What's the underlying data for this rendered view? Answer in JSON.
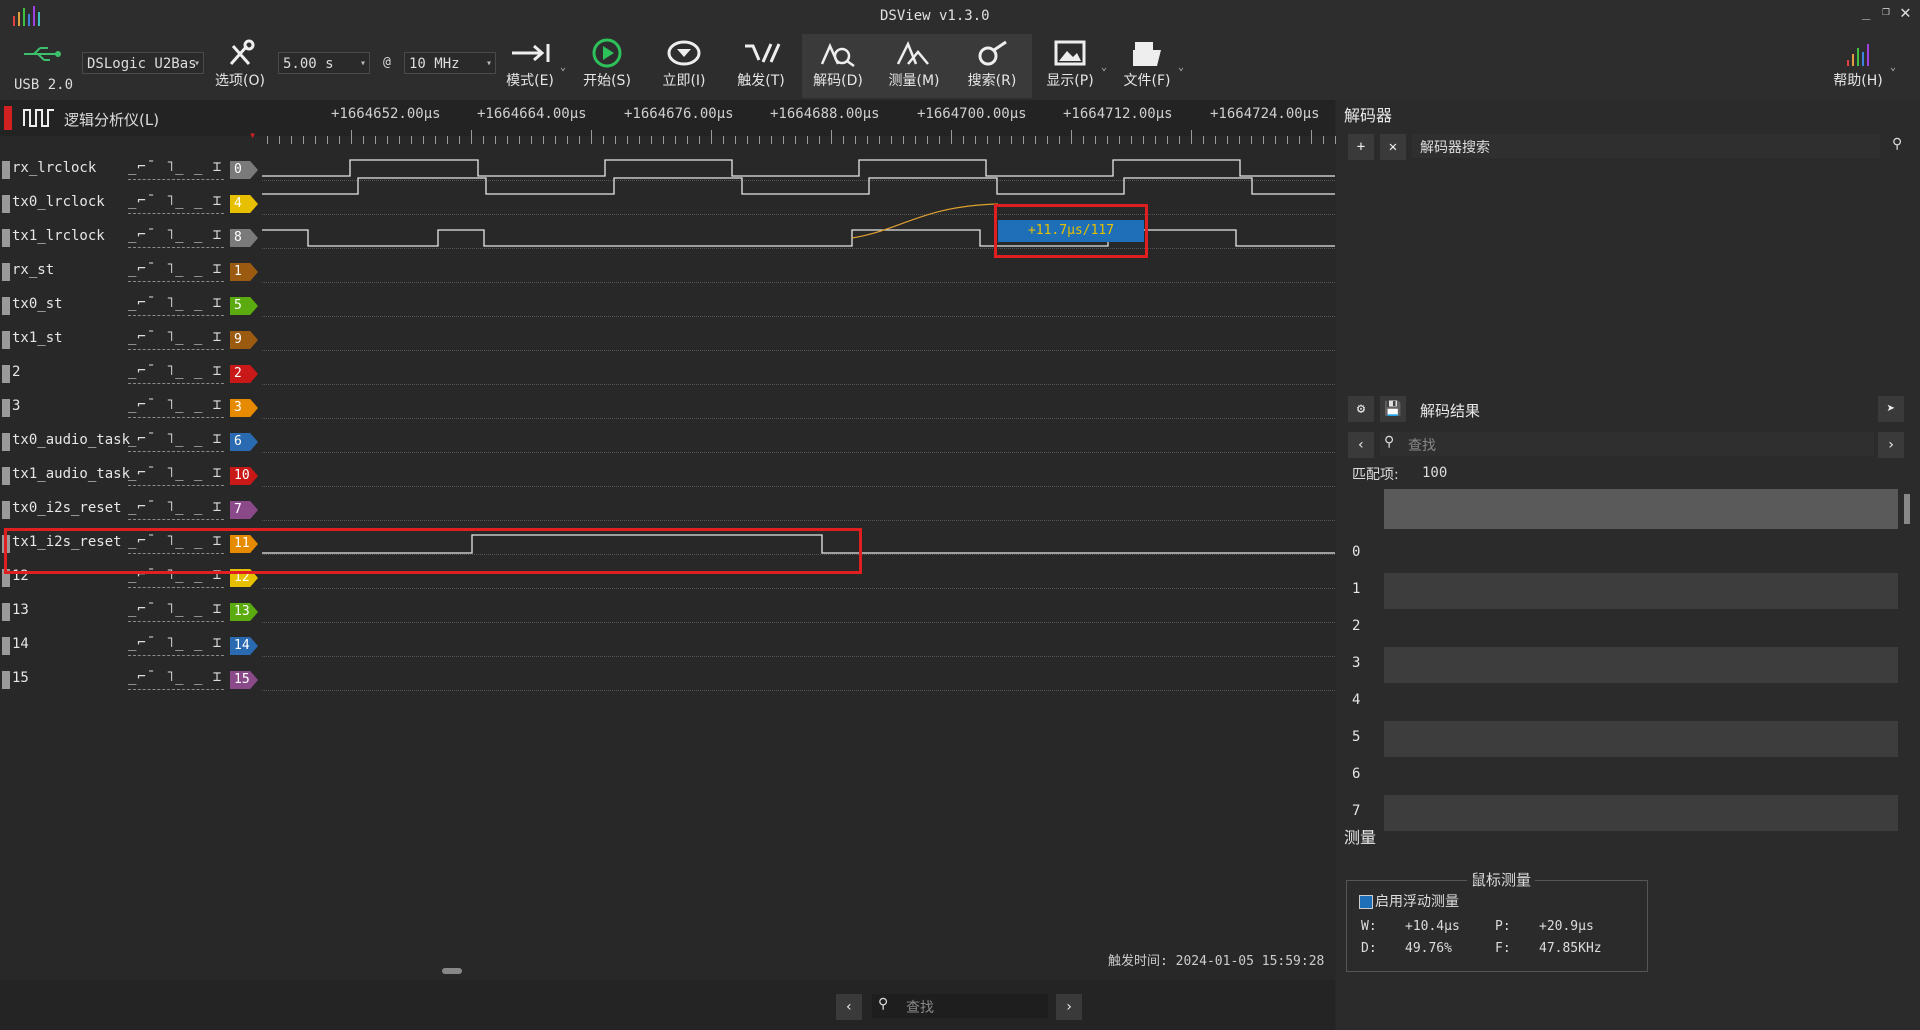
{
  "window": {
    "title": "DSView v1.3.0"
  },
  "toolbar": {
    "usb_label": "USB 2.0",
    "device": "DSLogic U2Bas",
    "options_label": "选项(O)",
    "duration": "5.00 s",
    "at": "@",
    "samplerate": "10 MHz",
    "mode_label": "模式(E)",
    "start_label": "开始(S)",
    "instant_label": "立即(I)",
    "trigger_label": "触发(T)",
    "decode_label": "解码(D)",
    "measure_label": "测量(M)",
    "search_label": "搜索(R)",
    "display_label": "显示(P)",
    "file_label": "文件(F)",
    "help_label": "帮助(H)"
  },
  "scope": {
    "title": "逻辑分析仪(L)",
    "ticks": [
      "+1664652.00μs",
      "+1664664.00μs",
      "+1664676.00μs",
      "+1664688.00μs",
      "+1664700.00μs",
      "+1664712.00μs",
      "+1664724.00μs"
    ],
    "trigger_glyphs": "_⌐¯ ˥_ _ ⌶",
    "cursor_label": "+11.7μs/117",
    "trigger_time": "触发时间: 2024-01-05 15:59:28"
  },
  "channels": [
    {
      "name": "rx_lrclock",
      "index": "0",
      "color": "#7a7a7a"
    },
    {
      "name": "tx0_lrclock",
      "index": "4",
      "color": "#e6c000"
    },
    {
      "name": "tx1_lrclock",
      "index": "8",
      "color": "#7a7a7a"
    },
    {
      "name": "rx_st",
      "index": "1",
      "color": "#9a5a10"
    },
    {
      "name": "tx0_st",
      "index": "5",
      "color": "#5aaa10"
    },
    {
      "name": "tx1_st",
      "index": "9",
      "color": "#9a5a10"
    },
    {
      "name": "2",
      "index": "2",
      "color": "#c81818"
    },
    {
      "name": "3",
      "index": "3",
      "color": "#e68a00"
    },
    {
      "name": "tx0_audio_task",
      "index": "6",
      "color": "#2a6ab0"
    },
    {
      "name": "tx1_audio_task",
      "index": "10",
      "color": "#c81818"
    },
    {
      "name": "tx0_i2s_reset",
      "index": "7",
      "color": "#8a4a8a"
    },
    {
      "name": "tx1_i2s_reset",
      "index": "11",
      "color": "#e68a00"
    },
    {
      "name": "12",
      "index": "12",
      "color": "#e6c000"
    },
    {
      "name": "13",
      "index": "13",
      "color": "#5aaa10"
    },
    {
      "name": "14",
      "index": "14",
      "color": "#2a6ab0"
    },
    {
      "name": "15",
      "index": "15",
      "color": "#8a4a8a"
    }
  ],
  "decoder": {
    "title": "解码器",
    "search_placeholder": "解码器搜索",
    "results_title": "解码结果",
    "find_placeholder": "查找",
    "match_label": "匹配项:",
    "match_count": "100",
    "rows": [
      "0",
      "1",
      "2",
      "3",
      "4",
      "5",
      "6",
      "7"
    ]
  },
  "measure": {
    "title": "测量",
    "box_title": "鼠标测量",
    "enable_label": "启用浮动测量",
    "w_label": "W:",
    "w_value": "+10.4μs",
    "p_label": "P:",
    "p_value": "+20.9μs",
    "d_label": "D:",
    "d_value": "49.76%",
    "f_label": "F:",
    "f_value": "47.85KHz"
  },
  "bottom": {
    "find_placeholder": "查找"
  },
  "colors": {
    "accent": "#1e6fb8",
    "highlight": "#e02020",
    "trace": "#e6e6e6"
  }
}
